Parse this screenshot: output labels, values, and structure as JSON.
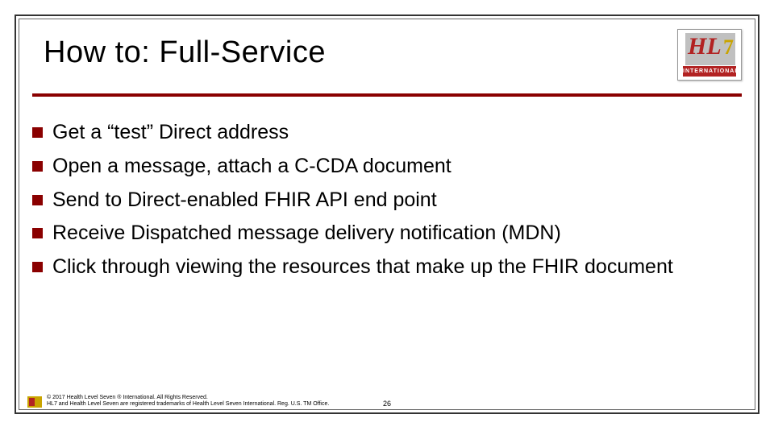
{
  "title": "How to: Full-Service",
  "logo": {
    "hl_text": "HL",
    "seven_text": "7",
    "banner_text": "INTERNATIONAL"
  },
  "bullets": [
    "Get a “test” Direct address",
    "Open a message, attach a C-CDA document",
    "Send to Direct-enabled FHIR API end point",
    "Receive Dispatched message delivery notification (MDN)",
    "Click through viewing the resources that make up the FHIR document"
  ],
  "footer": {
    "line1": "© 2017 Health Level Seven ® International. All Rights Reserved.",
    "line2": "HL7 and Health Level Seven are registered trademarks of Health Level Seven International. Reg. U.S. TM Office."
  },
  "page_number": "26"
}
